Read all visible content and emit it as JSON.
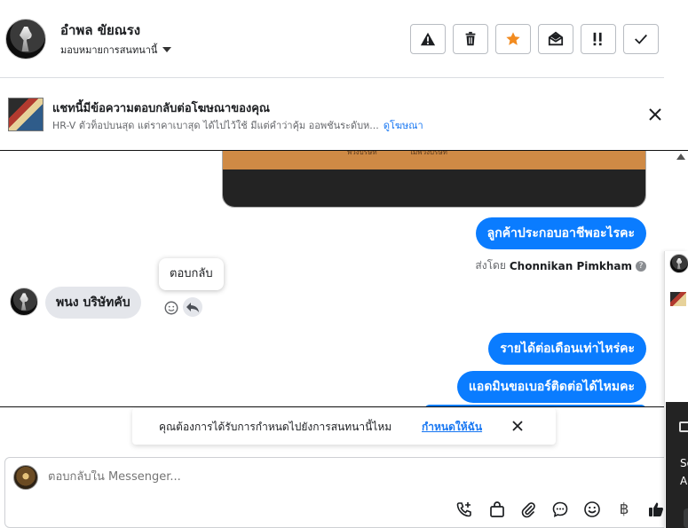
{
  "header": {
    "contact_name": "อำพล ขัยณรง",
    "assign_label": "มอบหมายการสนทนานี้",
    "tools": [
      {
        "name": "report-icon"
      },
      {
        "name": "trash-icon"
      },
      {
        "name": "star-icon"
      },
      {
        "name": "mark-unread-icon"
      },
      {
        "name": "follow-up-icon"
      },
      {
        "name": "done-icon"
      }
    ]
  },
  "ad_banner": {
    "title": "แชทนี้มีข้อความตอบกลับต่อโฆษณาของคุณ",
    "description": "HR-V ตัวท็อปบนสุด แต่ราคาเบาสุด ได้ไปไว้ใช้ มีแต่คำว่าคุ้ม ออพชันระดับห...",
    "link": "ดูโฆษณา"
  },
  "thread": {
    "card_options": [
      "พ่วงบริษัท",
      "ไม่พ่วงบริษัท"
    ],
    "outgoing_1": "ลูกค้าประกอบอาชีพอะไรคะ",
    "sent_by_label": "ส่งโดย",
    "sent_by_name": "Chonnikan Pimkham",
    "incoming_1": "พนง  บริษัทคับ",
    "tooltip": "ตอบกลับ",
    "outgoing_2": "รายได้ต่อเดือนเท่าไหร่คะ",
    "outgoing_3": "แอดมินขอเบอร์ติดต่อได้ไหมคะ"
  },
  "assign_prompt": {
    "text": "คุณต้องการได้รับการกำหนดไปยังการสนทนานี้ไหม",
    "link": "กำหนดให้ฉัน"
  },
  "composer": {
    "placeholder": "ตอบกลับใน Messenger...",
    "tools": [
      "call-add-icon",
      "shopping-bag-icon",
      "paperclip-icon",
      "chat-bubble-icon",
      "emoji-icon",
      "baht-icon",
      "thumbs-up-icon"
    ],
    "baht_symbol": "฿"
  },
  "side_panel": {
    "text_1": "So",
    "text_2": "A"
  },
  "colors": {
    "accent": "#0a7cff",
    "link": "#1877f2",
    "star": "#f28b20"
  }
}
